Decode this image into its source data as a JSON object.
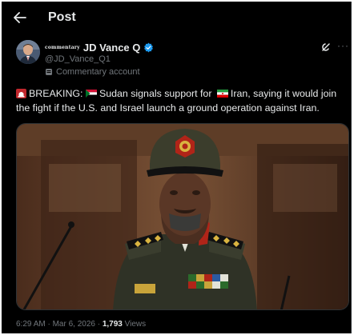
{
  "header": {
    "title": "Post",
    "back_icon": "arrow-left-icon"
  },
  "author": {
    "name_prefix": "commentary",
    "name": "JD Vance Q",
    "handle": "@JD_Vance_Q1",
    "label": "Commentary account",
    "verified_color": "#1d9bf0"
  },
  "tweet": {
    "breaking": "BREAKING:",
    "text_part1": "Sudan signals support for",
    "text_part2": "Iran, saying it would join the fight if the U.S. and Israel launch a ground operation against Iran."
  },
  "meta": {
    "timestamp": "6:29 AM · Mar 6, 2026 · ",
    "views_count": "1,793",
    "views_label": " Views"
  },
  "colors": {
    "background": "#000000",
    "text": "#e7e9ea",
    "muted": "#71767b",
    "accent": "#1d9bf0"
  }
}
